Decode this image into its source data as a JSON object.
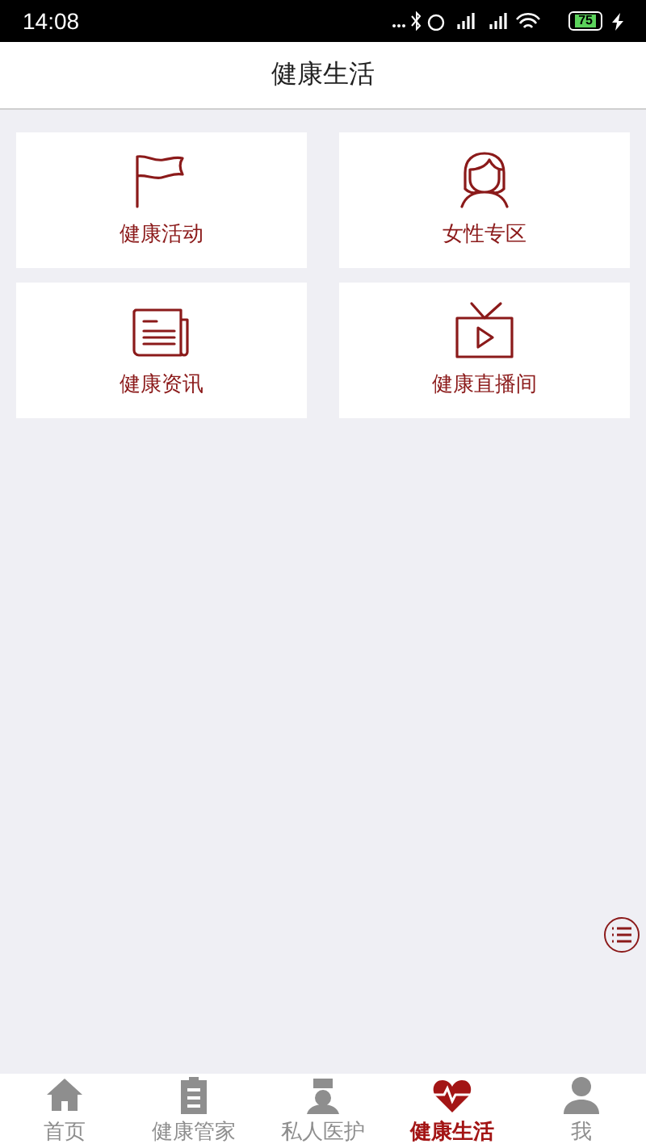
{
  "status_bar": {
    "time": "14:08",
    "battery": "75"
  },
  "header": {
    "title": "健康生活"
  },
  "tiles": [
    {
      "label": "健康活动"
    },
    {
      "label": "女性专区"
    },
    {
      "label": "健康资讯"
    },
    {
      "label": "健康直播间"
    }
  ],
  "tabs": [
    {
      "label": "首页",
      "selected": false
    },
    {
      "label": "健康管家",
      "selected": false
    },
    {
      "label": "私人医护",
      "selected": false
    },
    {
      "label": "健康生活",
      "selected": true
    },
    {
      "label": "我",
      "selected": false
    }
  ]
}
